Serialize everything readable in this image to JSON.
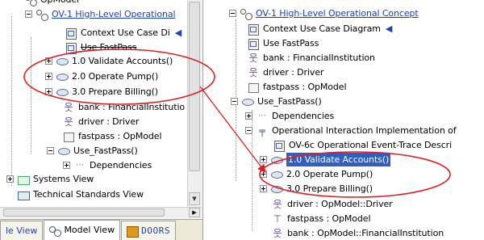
{
  "left_tree": {
    "top_partial": "OpModel",
    "root": "OV-1 High-Level Operational",
    "items": [
      {
        "label": "Context Use Case Di"
      },
      {
        "label": "Use FastPass"
      },
      {
        "label": "1.0 Validate Accounts()"
      },
      {
        "label": "2.0 Operate Pump()"
      },
      {
        "label": "3.0 Prepare Billing()"
      },
      {
        "label": "bank : FinancialInstitutio"
      },
      {
        "label": "driver : Driver"
      },
      {
        "label": "fastpass : OpModel"
      },
      {
        "label": "Use_FastPass()"
      },
      {
        "label": "Dependencies"
      }
    ],
    "systems_view": "Systems View",
    "technical_standards": "Technical Standards View"
  },
  "tabs": [
    {
      "label": "le View"
    },
    {
      "label": "Model View"
    },
    {
      "label": "DOORS"
    }
  ],
  "right_tree": {
    "root": "OV-1 High-Level Operational Concept",
    "items": [
      {
        "label": "Context Use Case Diagram"
      },
      {
        "label": "Use FastPass"
      },
      {
        "label": "bank : FinancialInstitution"
      },
      {
        "label": "driver : Driver"
      },
      {
        "label": "fastpass : OpModel"
      },
      {
        "label": "Use_FastPass()"
      },
      {
        "label": "Dependencies"
      },
      {
        "label": "Operational Interaction Implementation of"
      },
      {
        "label": "OV-6c Operational Event-Trace Descri"
      },
      {
        "label": "1.0 Validate Accounts()"
      },
      {
        "label": "2.0 Operate Pump()"
      },
      {
        "label": "3.0 Prepare Billing()"
      },
      {
        "label": "driver : OpModel::Driver"
      },
      {
        "label": "fastpass : OpModel"
      },
      {
        "label": "bank : OpModel::FinancialInstitution"
      }
    ]
  },
  "colors": {
    "link": "#1a3fc8",
    "highlight_circle": "#e02020",
    "selection": "#2f5ec4"
  }
}
